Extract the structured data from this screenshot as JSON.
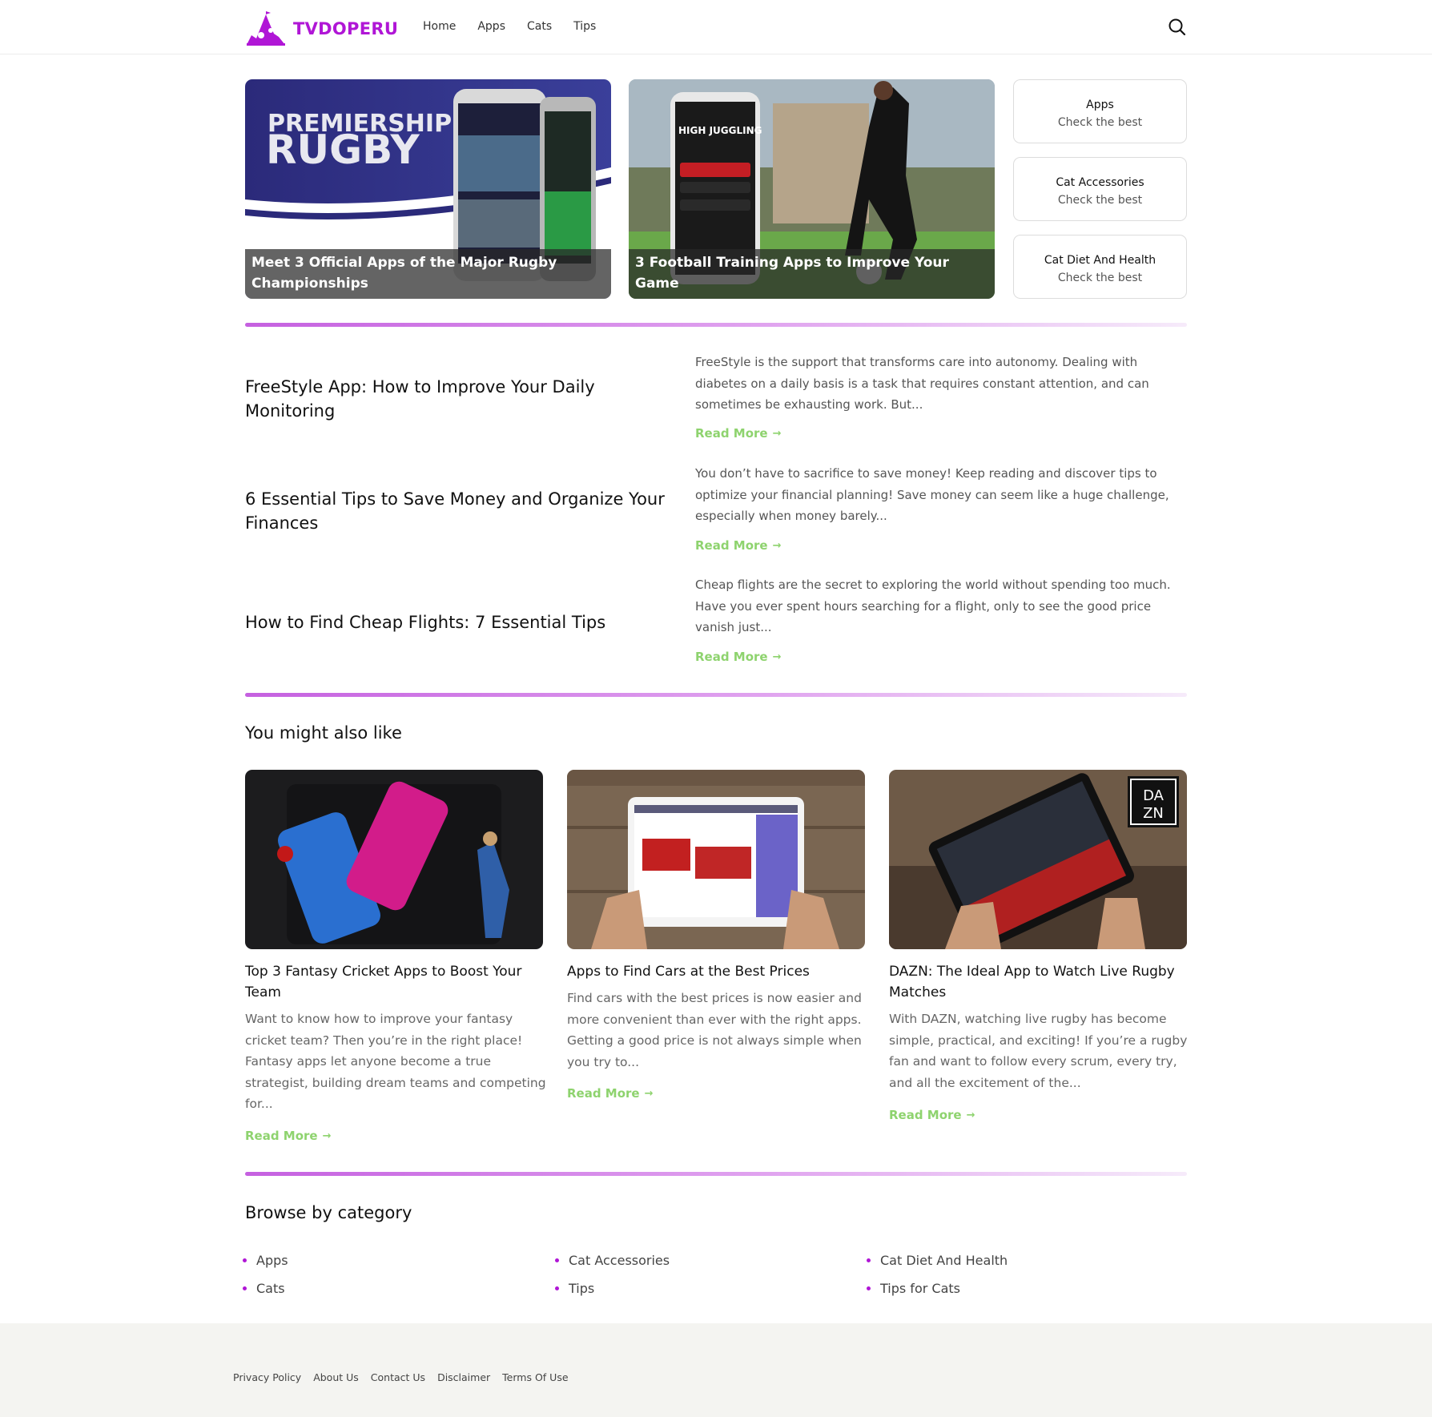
{
  "brand": {
    "name": "TVDOPERU",
    "color": "#b016d6"
  },
  "nav": [
    "Home",
    "Apps",
    "Cats",
    "Tips"
  ],
  "hero": [
    {
      "caption": "Meet 3 Official Apps of the Major Rugby Championships",
      "image_text_1": "PREMIERSHIP",
      "image_text_2": "RUGBY"
    },
    {
      "caption": "3 Football Training Apps to Improve Your Game",
      "image_text": "HIGH JUGGLING"
    }
  ],
  "side_boxes": [
    {
      "title": "Apps",
      "sub": "Check the best"
    },
    {
      "title": "Cat Accessories",
      "sub": "Check the best"
    },
    {
      "title": "Cat Diet And Health",
      "sub": "Check the best"
    }
  ],
  "articles": [
    {
      "title": "FreeStyle App: How to Improve Your Daily Monitoring",
      "excerpt": "FreeStyle is the support that transforms care into autonomy. Dealing with diabetes on a daily basis is a task that requires constant attention, and can sometimes be exhausting work. But...",
      "read_more": "Read More"
    },
    {
      "title": "6 Essential Tips to Save Money and Organize Your Finances",
      "excerpt": "You don’t have to sacrifice to save money! Keep reading and discover tips to optimize your financial planning! Save money can seem like a huge challenge, especially when money barely...",
      "read_more": "Read More"
    },
    {
      "title": "How to Find Cheap Flights: 7 Essential Tips",
      "excerpt": "Cheap flights are the secret to exploring the world without spending too much. Have you ever spent hours searching for a flight, only to see the good price vanish just...",
      "read_more": "Read More"
    }
  ],
  "related": {
    "heading": "You might also like",
    "items": [
      {
        "title": "Top 3 Fantasy Cricket Apps to Boost Your Team",
        "excerpt": "Want to know how to improve your fantasy cricket team? Then you’re in the right place! Fantasy apps let anyone become a true strategist, building dream teams and competing for...",
        "read_more": "Read More"
      },
      {
        "title": "Apps to Find Cars at the Best Prices",
        "excerpt": "Find cars with the best prices is now easier and more convenient than ever with the right apps. Getting a good price is not always simple when you try to...",
        "read_more": "Read More"
      },
      {
        "title": "DAZN: The Ideal App to Watch Live Rugby Matches",
        "excerpt": "With DAZN, watching live rugby has become simple, practical, and exciting! If you’re a rugby fan and want to follow every scrum, every try, and all the excitement of the...",
        "read_more": "Read More",
        "logo_text": [
          "DA",
          "ZN"
        ]
      }
    ]
  },
  "categories": {
    "heading": "Browse by category",
    "items": [
      "Apps",
      "Cat Accessories",
      "Cat Diet And Health",
      "Cats",
      "Tips",
      "Tips for Cats"
    ]
  },
  "footer": [
    "Privacy Policy",
    "About Us",
    "Contact Us",
    "Disclaimer",
    "Terms Of Use"
  ],
  "colors": {
    "accent": "#b016d6",
    "read_more": "#8ed36e",
    "footer_bg": "#f4f4f1"
  }
}
